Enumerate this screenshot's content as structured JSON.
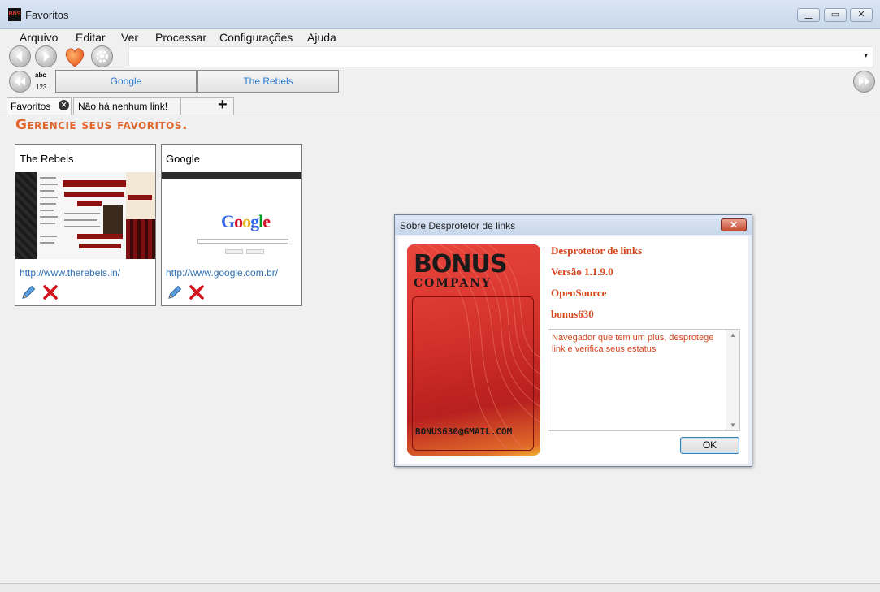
{
  "window": {
    "title": "Favoritos",
    "app_icon_text": "BNS"
  },
  "window_controls": {
    "minimize": "▁",
    "maximize": "▭",
    "close": "✕"
  },
  "menu": [
    "Arquivo",
    "Editar",
    "Ver",
    "Processar",
    "Configurações",
    "Ajuda"
  ],
  "toolbar": {
    "icons": [
      "back-arrow-icon",
      "forward-arrow-icon",
      "heart-icon",
      "gear-icon"
    ],
    "address_value": "",
    "dropdown_glyph": "▾"
  },
  "favorites_bar": {
    "abc_label": "abc",
    "num_label": "123",
    "buttons": [
      "Google",
      "The Rebels"
    ]
  },
  "tabs": {
    "items": [
      "Favoritos",
      "Não há nenhum link!"
    ],
    "close_glyph": "✕",
    "add_glyph": "+"
  },
  "heading": "Gerencie seus favoritos.",
  "cards": [
    {
      "title": "The Rebels",
      "url": "http://www.therebels.in/"
    },
    {
      "title": "Google",
      "url": "http://www.google.com.br/"
    }
  ],
  "google_logo": {
    "letters": [
      "G",
      "o",
      "o",
      "g",
      "l",
      "e"
    ],
    "colors": [
      "#3369e8",
      "#d50f25",
      "#eeb211",
      "#3369e8",
      "#009925",
      "#d50f25"
    ]
  },
  "dialog": {
    "title": "Sobre Desprotetor de links",
    "close_glyph": "✕",
    "logo_text": "BONUS",
    "logo_subtext": "COMPANY",
    "logo_email": "BONUS630@GMAIL.COM",
    "product": "Desprotetor de links",
    "version": "Versão 1.1.9.0",
    "license": "OpenSource",
    "author": "bonus630",
    "description": "Navegador que tem um plus, desprotege link e verifica seus estatus",
    "ok_label": "OK"
  },
  "colors": {
    "accent_orange": "#e2662c",
    "link_blue": "#2a6fb5",
    "dialog_text": "#d4461d"
  }
}
